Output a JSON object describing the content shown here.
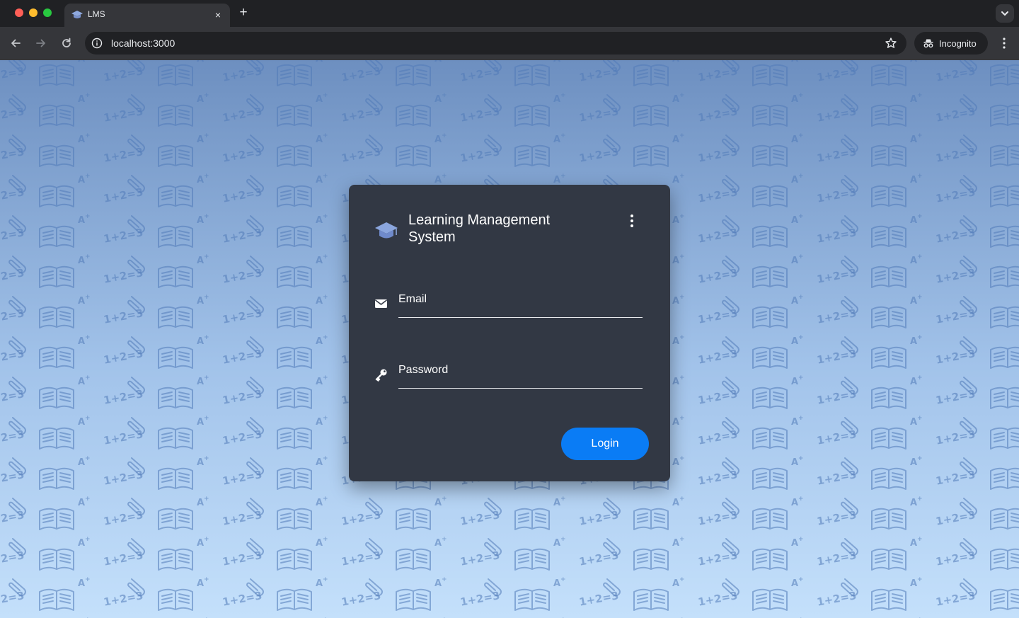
{
  "browser": {
    "tab_title": "LMS",
    "tab_close_glyph": "×",
    "new_tab_glyph": "+",
    "url": "localhost:3000",
    "incognito_label": "Incognito",
    "icons": [
      "tab-search-icon",
      "back-arrow-icon",
      "forward-arrow-icon",
      "reload-icon",
      "site-info-icon",
      "bookmark-star-icon",
      "incognito-icon",
      "more-menu-icon"
    ]
  },
  "background": {
    "pattern_items": [
      "1+2=3",
      "A+",
      "book-icon",
      "paperclip-icon"
    ],
    "colors": {
      "top": "#6d8fc0",
      "bottom": "#c4e0fb"
    }
  },
  "login": {
    "title": "Learning Management System",
    "brand_icon": "graduation-cap-icon",
    "menu_icon": "kebab-menu-icon",
    "email_label": "Email",
    "email_icon": "envelope-icon",
    "password_label": "Password",
    "password_icon": "key-icon",
    "login_button": "Login",
    "colors": {
      "card": "#323844",
      "button": "#0a7cf5",
      "text": "#ffffff"
    }
  }
}
